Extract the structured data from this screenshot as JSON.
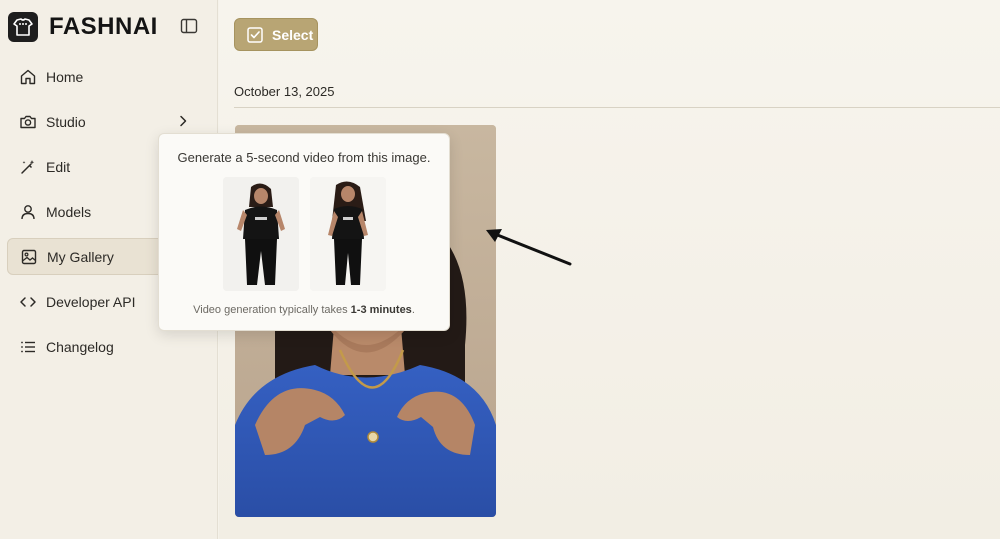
{
  "app": {
    "brand": "FASHNAI"
  },
  "sidebar": {
    "items": [
      {
        "label": "Home",
        "icon": "home-icon"
      },
      {
        "label": "Studio",
        "icon": "camera-icon",
        "has_submenu": true
      },
      {
        "label": "Edit",
        "icon": "magic-wand-icon"
      },
      {
        "label": "Models",
        "icon": "user-icon"
      },
      {
        "label": "My Gallery",
        "icon": "image-icon",
        "active": true
      },
      {
        "label": "Developer API",
        "icon": "code-icon"
      },
      {
        "label": "Changelog",
        "icon": "list-icon"
      }
    ]
  },
  "toolbar": {
    "select_label": "Select"
  },
  "gallery": {
    "date_label": "October 13, 2025"
  },
  "popover": {
    "title": "Generate a 5-second video from this image.",
    "note_prefix": "Video generation typically takes ",
    "note_bold": "1-3 minutes",
    "note_suffix": "."
  },
  "card_actions": [
    "heart-icon",
    "magic-wand-icon",
    "video-icon",
    "image-resize-icon"
  ],
  "colors": {
    "accent": "#b8a574",
    "sidebar_bg": "#f3efe6",
    "main_bg": "#f5f2ea",
    "shirt_blue": "#2f57b5"
  }
}
